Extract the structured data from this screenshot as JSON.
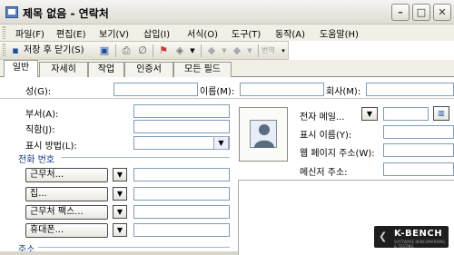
{
  "window": {
    "title": "제목 없음 - 연락처",
    "minimize_label": "–",
    "maximize_label": "□",
    "close_label": "✕"
  },
  "menu": [
    "파일(F)",
    "편집(E)",
    "보기(V)",
    "삽입(I)",
    "서식(O)",
    "도구(T)",
    "동작(A)",
    "도움말(H)"
  ],
  "toolbar": {
    "save_close": "저장 후 닫기(S)",
    "nav_label": "번역"
  },
  "tabs": [
    "일반",
    "자세히",
    "작업",
    "인증서",
    "모든 필드"
  ],
  "active_tab": "일반",
  "general": {
    "last_name_label": "성(G):",
    "first_name_label": "이름(M):",
    "company_label": "회사(M):",
    "department_label": "부서(A):",
    "job_title_label": "직함(J):",
    "file_as_label": "표시 방법(L):",
    "phone_section": "전화 번호",
    "phone_buttons": [
      "근무처...",
      "집...",
      "근무처 팩스...",
      "휴대폰..."
    ],
    "address_section": "주소",
    "email_label": "전자 메일...",
    "display_name_label": "표시 이름(Y):",
    "web_label": "웹 페이지 주소(W):",
    "im_label": "메신저 주소:"
  },
  "watermark": {
    "brand": "K-BENCH",
    "tagline": "SOFTWARE BENCHMARKING & TESTING"
  },
  "colors": {
    "section_title": "#0e3a8c",
    "input_border": "#7f9db9",
    "chrome": "#f1efe6"
  }
}
